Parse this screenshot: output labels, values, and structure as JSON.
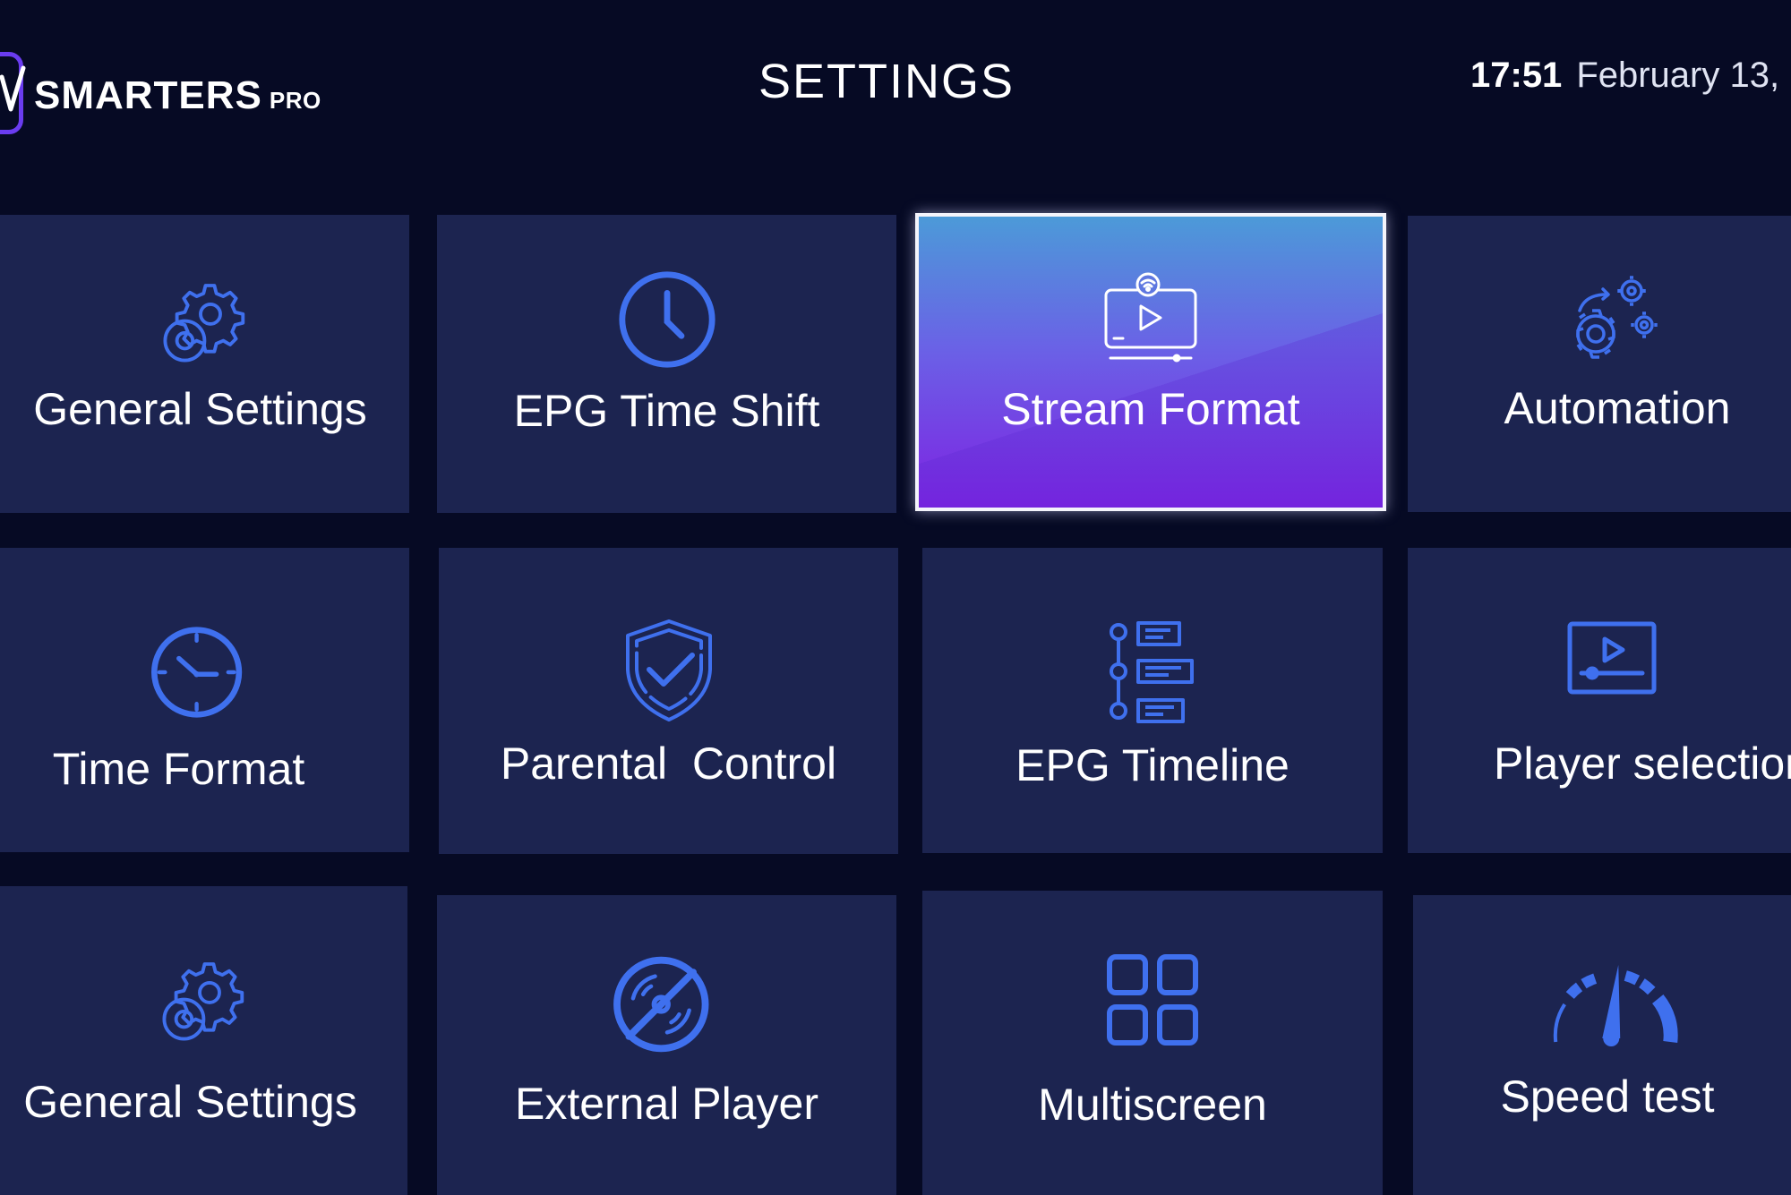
{
  "header": {
    "logo_text": "SMARTERS",
    "logo_sub": "PRO",
    "title": "SETTINGS",
    "time": "17:51",
    "date": "February 13,"
  },
  "colors": {
    "background": "#060a24",
    "tile": "#1c2450",
    "icon": "#3f70ee",
    "active_top": "#4c9ad8",
    "active_bottom": "#7e22e2"
  },
  "tiles": [
    {
      "label": "General Settings",
      "icon": "gear-icon"
    },
    {
      "label": "EPG Time Shift",
      "icon": "clock-icon"
    },
    {
      "label": "Stream Format",
      "icon": "tv-stream-icon",
      "selected": true
    },
    {
      "label": "Automation",
      "icon": "gears-icon"
    },
    {
      "label": "Time Format",
      "icon": "clock-icon"
    },
    {
      "label": "Parental  Control",
      "icon": "shield-check-icon"
    },
    {
      "label": "EPG Timeline",
      "icon": "timeline-icon"
    },
    {
      "label": "Player selection",
      "icon": "player-icon"
    },
    {
      "label": "General Settings",
      "icon": "gear-icon"
    },
    {
      "label": "External Player",
      "icon": "disc-off-icon"
    },
    {
      "label": "Multiscreen",
      "icon": "grid-icon"
    },
    {
      "label": "Speed test",
      "icon": "speedometer-icon"
    }
  ]
}
